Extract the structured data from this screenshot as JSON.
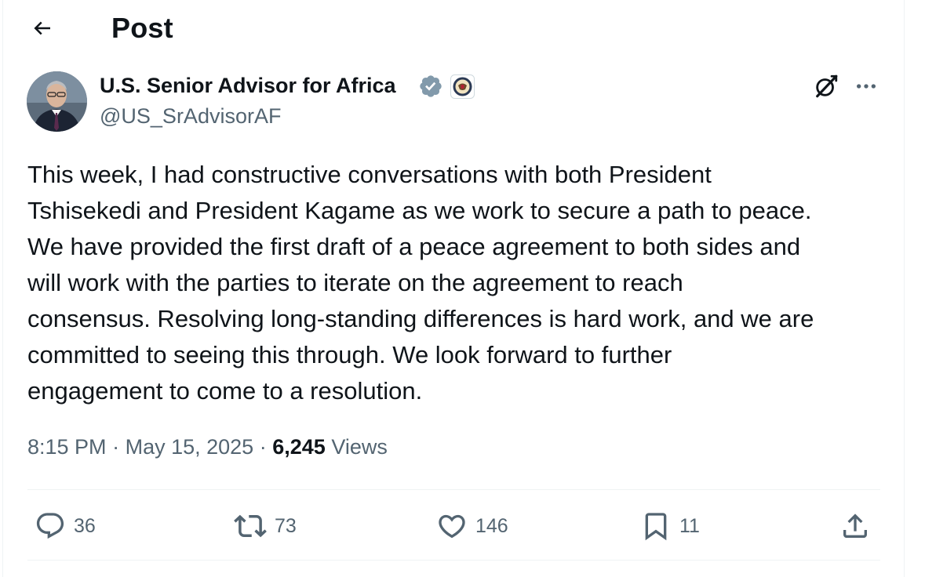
{
  "header": {
    "back_icon": "arrow-left-icon",
    "title": "Post"
  },
  "post": {
    "author": {
      "name": "U.S. Senior Advisor for Africa",
      "handle": "@US_SrAdvisorAF",
      "verified_icon": "verified-badge-icon",
      "affiliate_icon": "state-department-seal-icon"
    },
    "text": "This week, I had constructive conversations with both President\nTshisekedi and President Kagame as we work to secure a path to peace.\nWe have provided the first draft of a peace agreement to both sides and\nwill work with the parties to iterate on the agreement to reach\nconsensus. Resolving long-standing differences is hard work, and we are\ncommitted to seeing this through. We look forward to further\nengagement to come to a resolution.",
    "time": "8:15 PM",
    "separator": "·",
    "date": "May 15, 2025",
    "views_count": "6,245",
    "views_label": "Views"
  },
  "actions": {
    "reply": {
      "icon": "reply-icon",
      "count": "36"
    },
    "retweet": {
      "icon": "retweet-icon",
      "count": "73"
    },
    "like": {
      "icon": "heart-icon",
      "count": "146"
    },
    "bookmark": {
      "icon": "bookmark-icon",
      "count": "11"
    },
    "share": {
      "icon": "share-icon"
    }
  },
  "colors": {
    "text_primary": "#0f1419",
    "text_secondary": "#536471",
    "verified_blue": "#1d9bf0",
    "divider": "#eff3f4"
  }
}
